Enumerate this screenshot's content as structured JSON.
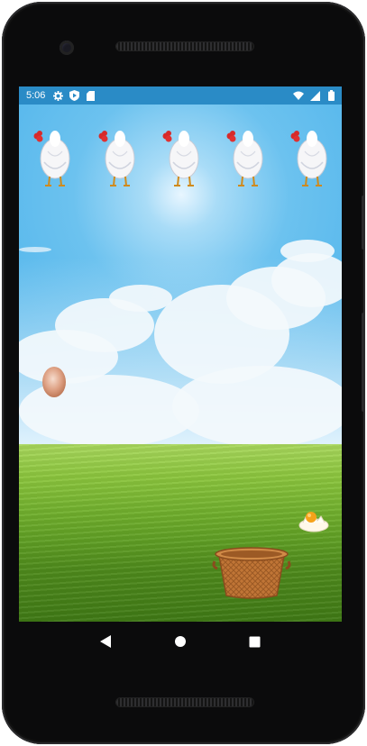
{
  "status_bar": {
    "time": "5:06",
    "left_icons": [
      "settings-icon",
      "play-protect-icon",
      "sd-card-icon"
    ],
    "right_icons": [
      "wifi-icon",
      "cellular-signal-icon",
      "battery-icon"
    ],
    "color": "#2a8bc6"
  },
  "game": {
    "hens": [
      {
        "id": 1,
        "icon": "hen-icon"
      },
      {
        "id": 2,
        "icon": "hen-icon"
      },
      {
        "id": 3,
        "icon": "hen-icon"
      },
      {
        "id": 4,
        "icon": "hen-icon"
      },
      {
        "id": 5,
        "icon": "hen-icon"
      }
    ],
    "falling_egg": {
      "icon": "egg-icon",
      "color": "#d99a78"
    },
    "broken_egg": {
      "icon": "broken-egg-icon",
      "color": "#f6a21a"
    },
    "basket": {
      "icon": "basket-icon",
      "color": "#b9692d"
    },
    "sky_color": "#4fb4eb",
    "grass_color": "#6fae2c"
  },
  "navigation_bar": {
    "buttons": [
      "back-icon",
      "home-icon",
      "recents-icon"
    ]
  }
}
